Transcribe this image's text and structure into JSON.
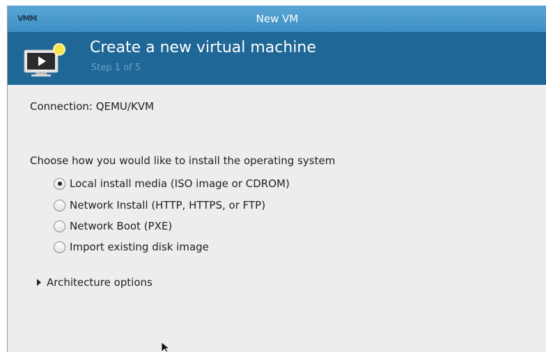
{
  "window": {
    "title": "New VM",
    "app_badge": "VMM"
  },
  "header": {
    "heading": "Create a new virtual machine",
    "step": "Step 1 of 5",
    "icon": "monitor-play-icon"
  },
  "connection": {
    "text": "Connection:  QEMU/KVM"
  },
  "install": {
    "question": "Choose how you would like to install the operating system",
    "options": [
      {
        "label": "Local install media (ISO image or CDROM)",
        "selected": true
      },
      {
        "label": "Network Install (HTTP, HTTPS, or FTP)",
        "selected": false
      },
      {
        "label": "Network Boot (PXE)",
        "selected": false
      },
      {
        "label": "Import existing disk image",
        "selected": false
      }
    ]
  },
  "architecture": {
    "label": "Architecture options",
    "expanded": false
  },
  "colors": {
    "titlebar": "#4a9ccf",
    "header": "#1e6796",
    "step_text": "#6aa3c8",
    "window_bg": "#ededed"
  }
}
